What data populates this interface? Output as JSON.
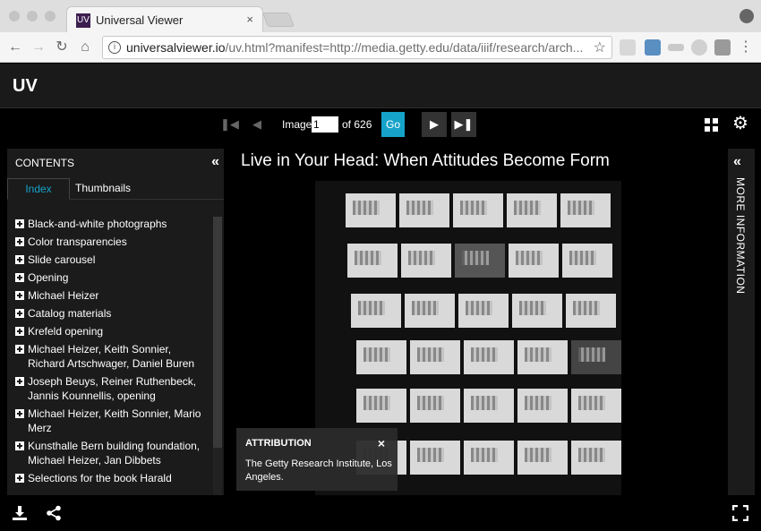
{
  "browser": {
    "tab_title": "Universal Viewer",
    "tab_favicon": "UV",
    "tab_close": "×",
    "url_host": "universalviewer.io",
    "url_rest": "/uv.html?manifest=http://media.getty.edu/data/iiif/research/arch..."
  },
  "app": {
    "logo": "UV"
  },
  "pager": {
    "image_label": "Image",
    "current_page": "1",
    "of_label": "of 626",
    "go_label": "Go"
  },
  "contents": {
    "title": "CONTENTS",
    "tabs": [
      "Index",
      "Thumbnails"
    ],
    "items": [
      "Black-and-white photographs",
      "Color transparencies",
      "Slide carousel",
      "Opening",
      "Michael Heizer",
      "Catalog materials",
      "Krefeld opening",
      "Michael Heizer, Keith Sonnier, Richard Artschwager, Daniel Buren",
      "Joseph Beuys, Reiner Ruthenbeck, Jannis Kounnellis, opening",
      "Michael Heizer, Keith Sonnier, Mario Merz",
      "Kunsthalle Bern building foundation, Michael Heizer, Jan Dibbets",
      "Selections for the book Harald"
    ]
  },
  "main": {
    "title": "Live in Your Head: When Attitudes Become Form"
  },
  "attribution": {
    "title": "ATTRIBUTION",
    "close": "×",
    "text": "The Getty Research Institute, Los Angeles."
  },
  "right_panel": {
    "label": "MORE INFORMATION"
  },
  "colors": {
    "accent": "#16a3c9",
    "panel_bg": "#1b1b1b",
    "header_bg": "#1a1a1a"
  }
}
